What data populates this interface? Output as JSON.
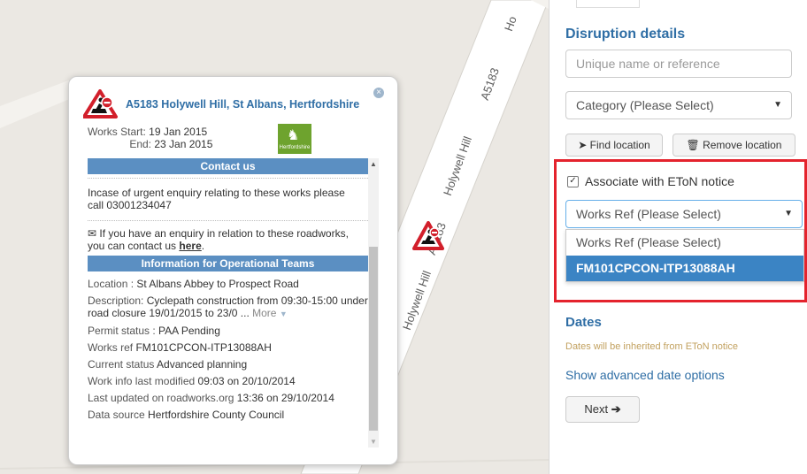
{
  "map": {
    "road_labels": [
      "Holywell Hill",
      "A5183",
      "Holywell Hill",
      "A5183",
      "Ho"
    ]
  },
  "popup": {
    "title": "A5183 Holywell Hill, St Albans, Hertfordshire",
    "works_start_label": "Works Start:",
    "works_start": "19 Jan 2015",
    "works_end_label": "End:",
    "works_end": "23 Jan 2015",
    "logo_text": "Hertfordshire",
    "contact_header": "Contact us",
    "contact_text": "Incase of urgent enquiry relating to these works please call 03001234047",
    "enquiry_text": "If you have an enquiry in relation to these roadworks, you can contact us",
    "enquiry_link": "here",
    "ops_header": "Information for Operational Teams",
    "location_label": "Location :",
    "location": "St Albans Abbey to Prospect Road",
    "description_label": "Description:",
    "description": "Cyclepath construction from 09:30-15:00 under road closure 19/01/2015 to 23/0 ...",
    "more_label": "More",
    "permit_label": "Permit status :",
    "permit": "PAA Pending",
    "works_ref_label": "Works ref",
    "works_ref": "FM101CPCON-ITP13088AH",
    "current_status_label": "Current status",
    "current_status": "Advanced planning",
    "modified_label": "Work info last modified",
    "modified": "09:03 on 20/10/2014",
    "updated_label": "Last updated on roadworks.org",
    "updated": "13:36 on 29/10/2014",
    "source_label": "Data source",
    "source": "Hertfordshire County Council"
  },
  "panel": {
    "disruption_title": "Disruption details",
    "name_placeholder": "Unique name or reference",
    "category_value": "Category (Please Select)",
    "find_location_label": "Find location",
    "remove_location_label": "Remove location",
    "associate_label": "Associate with EToN notice",
    "associate_checked": true,
    "works_ref_value": "Works Ref (Please Select)",
    "works_ref_options": [
      "Works Ref (Please Select)",
      "FM101CPCON-ITP13088AH"
    ],
    "dates_title": "Dates",
    "dates_note": "Dates will be inherited from EToN notice",
    "advanced_link": "Show advanced date options",
    "next_label": "Next"
  },
  "colors": {
    "accent": "#2f6ea5",
    "header_blue": "#5b8fc2",
    "highlight": "#e4232d",
    "selected": "#3b84c4"
  }
}
